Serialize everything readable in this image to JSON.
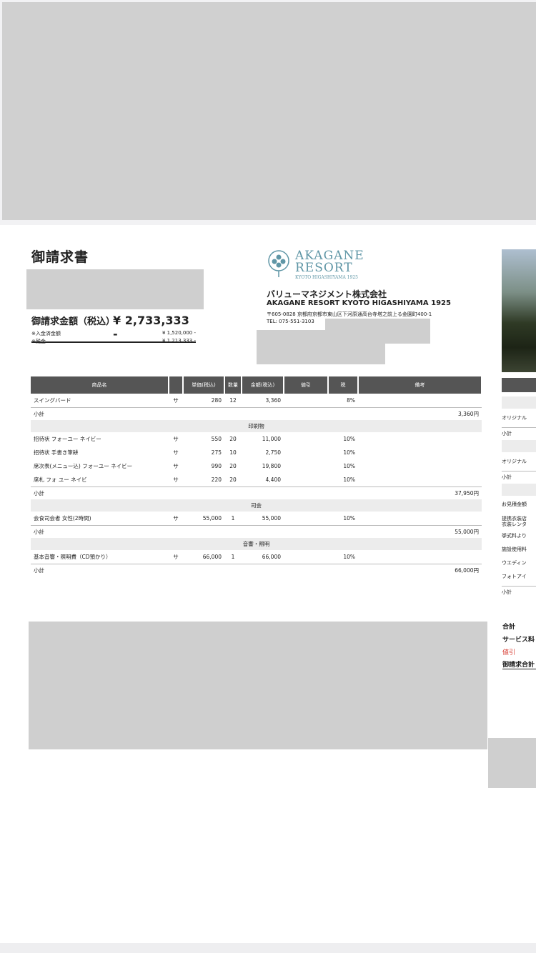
{
  "invoice": {
    "title": "御請求書",
    "amount_label": "御請求金額（税込）",
    "amount_value": "¥ 2,733,333 -",
    "paid_label": "※入金済金額",
    "paid_value": "¥ 1,520,000 -",
    "balance_label": "※残金",
    "balance_value": "¥ 1,213,333 -"
  },
  "company": {
    "logo_line1": "AKAGANE",
    "logo_line2": "RESORT",
    "logo_line3": "KYOTO HIGASHIYAMA 1925",
    "name_jp": "バリューマネジメント株式会社",
    "name_en": "AKAGANE RESORT KYOTO HIGASHIYAMA 1925",
    "address": "〒605-0828 京都府京都市東山区下河原通高台寺塔之前上る金園町400-1",
    "tel": "TEL: 075-551-3103"
  },
  "table": {
    "headers": [
      "商品名",
      "",
      "単価(税込)",
      "数量",
      "金額(税込)",
      "値引",
      "税",
      "備考"
    ],
    "rows": [
      {
        "type": "item",
        "name": "スイングバード",
        "mark": "サ",
        "price": "280",
        "qty": "12",
        "amount": "3,360",
        "discount": "",
        "tax": "8%",
        "note": ""
      },
      {
        "type": "subtotal",
        "label": "小計",
        "value": "3,360円"
      },
      {
        "type": "section",
        "label": "印刷物"
      },
      {
        "type": "item",
        "name": "招待状 フォーユー ネイビー",
        "mark": "サ",
        "price": "550",
        "qty": "20",
        "amount": "11,000",
        "discount": "",
        "tax": "10%",
        "note": ""
      },
      {
        "type": "item",
        "name": "招待状 手書き筆耕",
        "mark": "サ",
        "price": "275",
        "qty": "10",
        "amount": "2,750",
        "discount": "",
        "tax": "10%",
        "note": ""
      },
      {
        "type": "item",
        "name": "席次表(メニュー込) フォーユー ネイビー",
        "mark": "サ",
        "price": "990",
        "qty": "20",
        "amount": "19,800",
        "discount": "",
        "tax": "10%",
        "note": ""
      },
      {
        "type": "item",
        "name": "席札 フォ ユー ネイビ",
        "mark": "サ",
        "price": "220",
        "qty": "20",
        "amount": "4,400",
        "discount": "",
        "tax": "10%",
        "note": ""
      },
      {
        "type": "subtotal",
        "label": "小計",
        "value": "37,950円"
      },
      {
        "type": "section",
        "label": "司会"
      },
      {
        "type": "item",
        "name": "会食司会者 女性(2時間)",
        "mark": "サ",
        "price": "55,000",
        "qty": "1",
        "amount": "55,000",
        "discount": "",
        "tax": "10%",
        "note": ""
      },
      {
        "type": "subtotal",
        "label": "小計",
        "value": "55,000円"
      },
      {
        "type": "section",
        "label": "音響・照明"
      },
      {
        "type": "item",
        "name": "基本音響・照明費（CD預かり）",
        "mark": "サ",
        "price": "66,000",
        "qty": "1",
        "amount": "66,000",
        "discount": "",
        "tax": "10%",
        "note": ""
      },
      {
        "type": "subtotal",
        "label": "小計",
        "value": "66,000円"
      }
    ]
  },
  "right_column": {
    "labels": [
      "オリジナル",
      "小計",
      "オリジナル",
      "小計",
      "お見積金額",
      "提携衣装店",
      "衣装レンタ",
      "挙式料より",
      "施設使用料",
      "ウエディン",
      "フォトアイ",
      "小計"
    ],
    "totals": [
      "合計",
      "サービス料",
      "値引",
      "御請求合計"
    ],
    "discount_color": "#d9453b"
  }
}
